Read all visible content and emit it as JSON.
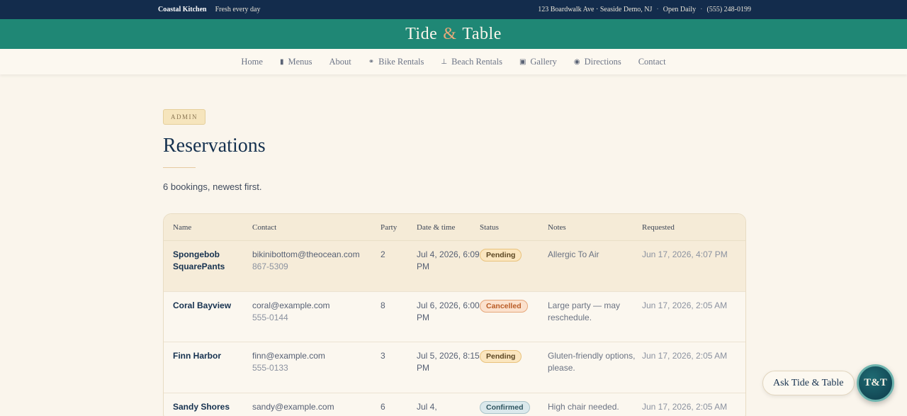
{
  "topbar": {
    "brand": "Coastal Kitchen",
    "tagline": "Fresh every day",
    "address": "123 Boardwalk Ave · Seaside Demo, NJ",
    "hours": "Open Daily",
    "phone": "(555) 248-0199"
  },
  "banner": {
    "title_left": "Tide",
    "amp": "&",
    "title_right": "Table"
  },
  "nav": [
    {
      "label": "Home",
      "icon": ""
    },
    {
      "label": "Menus",
      "icon": "menu-book-icon"
    },
    {
      "label": "About",
      "icon": ""
    },
    {
      "label": "Bike Rentals",
      "icon": "bike-icon"
    },
    {
      "label": "Beach Rentals",
      "icon": "umbrella-icon"
    },
    {
      "label": "Gallery",
      "icon": "image-icon"
    },
    {
      "label": "Directions",
      "icon": "map-pin-icon"
    },
    {
      "label": "Contact",
      "icon": ""
    }
  ],
  "page": {
    "badge": "ADMIN",
    "title": "Reservations",
    "subtitle": "6 bookings, newest first."
  },
  "table": {
    "headers": [
      "Name",
      "Contact",
      "Party",
      "Date & time",
      "Status",
      "Notes",
      "Requested"
    ],
    "rows": [
      {
        "name": "Spongebob SquarePants",
        "email": "bikinibottom@theocean.com",
        "phone": "867-5309",
        "party": "2",
        "date": "Jul 4, 2026, 6:09 PM",
        "status": "Pending",
        "notes": "Allergic To Air",
        "requested": "Jun 17, 2026, 4:07 PM"
      },
      {
        "name": "Coral Bayview",
        "email": "coral@example.com",
        "phone": "555-0144",
        "party": "8",
        "date": "Jul 6, 2026, 6:00 PM",
        "status": "Cancelled",
        "notes": "Large party — may reschedule.",
        "requested": "Jun 17, 2026, 2:05 AM"
      },
      {
        "name": "Finn Harbor",
        "email": "finn@example.com",
        "phone": "555-0133",
        "party": "3",
        "date": "Jul 5, 2026, 8:15 PM",
        "status": "Pending",
        "notes": "Gluten-friendly options, please.",
        "requested": "Jun 17, 2026, 2:05 AM"
      },
      {
        "name": "Sandy Shores",
        "email": "sandy@example.com",
        "phone": "",
        "party": "6",
        "date": "Jul 4,",
        "status": "Confirmed",
        "notes": "High chair needed.",
        "requested": "Jun 17, 2026, 2:05 AM"
      }
    ]
  },
  "assistant": {
    "ask_label": "Ask Tide & Table",
    "fab_label": "T&T"
  }
}
